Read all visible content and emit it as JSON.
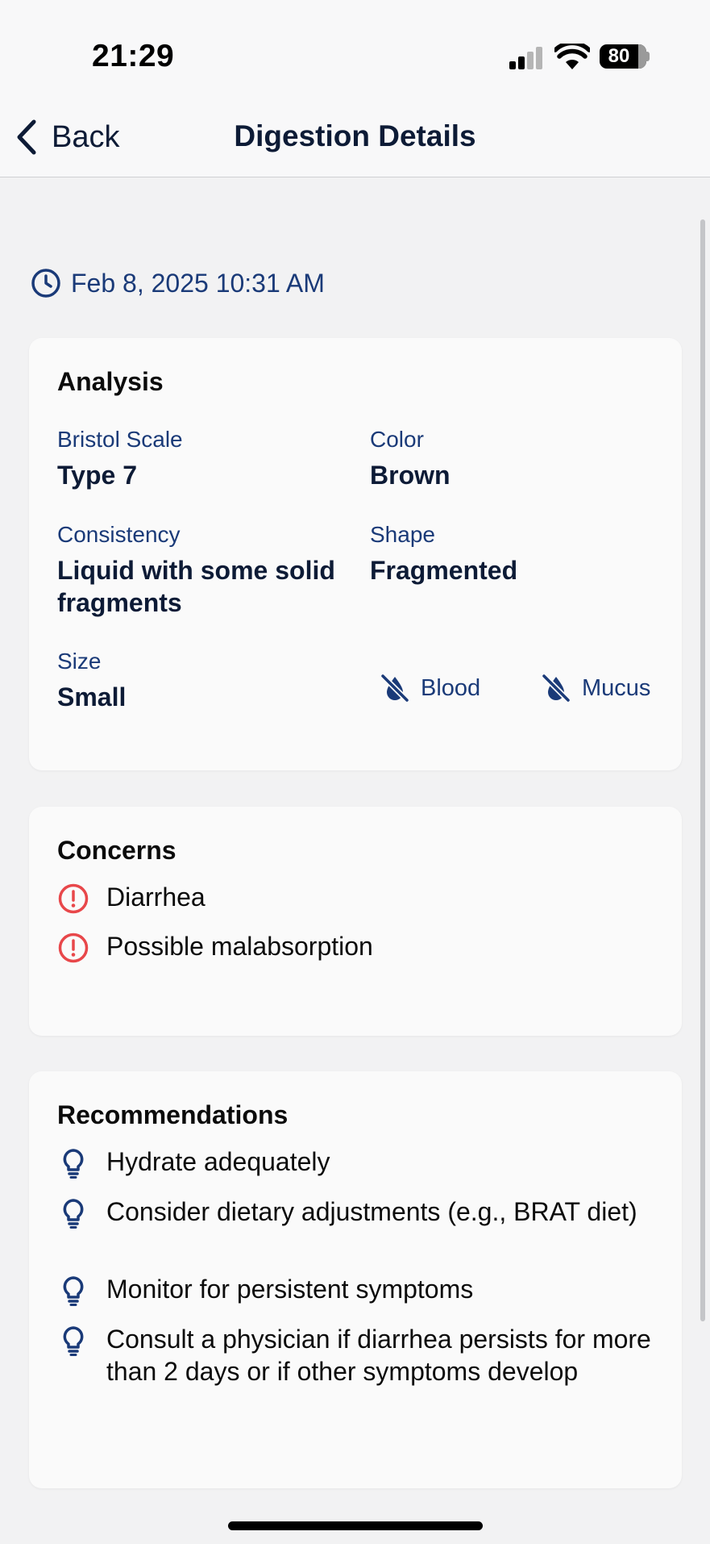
{
  "status_bar": {
    "time": "21:29",
    "battery": "80"
  },
  "nav": {
    "back_label": "Back",
    "title": "Digestion Details"
  },
  "timestamp": "Feb 8, 2025 10:31 AM",
  "analysis": {
    "title": "Analysis",
    "bristol_label": "Bristol Scale",
    "bristol_value": "Type 7",
    "color_label": "Color",
    "color_value": "Brown",
    "consistency_label": "Consistency",
    "consistency_value": "Liquid with some solid fragments",
    "shape_label": "Shape",
    "shape_value": "Fragmented",
    "size_label": "Size",
    "size_value": "Small",
    "blood_label": "Blood",
    "mucus_label": "Mucus"
  },
  "concerns": {
    "title": "Concerns",
    "items": [
      "Diarrhea",
      "Possible malabsorption"
    ]
  },
  "recommendations": {
    "title": "Recommendations",
    "items": [
      "Hydrate adequately",
      "Consider dietary adjustments (e.g., BRAT diet)",
      "Monitor for persistent symptoms",
      "Consult a physician if diarrhea persists for more than 2 days or if other symptoms develop"
    ]
  },
  "colors": {
    "accent": "#1a3a78",
    "text_dark": "#0d1b36",
    "warning": "#e8474a",
    "background": "#f2f2f3"
  },
  "icons": {
    "back": "chevron-left-icon",
    "clock": "clock-icon",
    "blood": "drop-slash-icon",
    "mucus": "drop-slash-icon",
    "concern": "exclamation-circle-icon",
    "recommendation": "lightbulb-icon"
  }
}
